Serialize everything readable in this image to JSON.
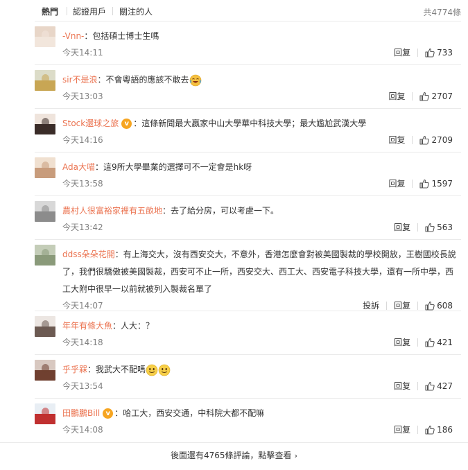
{
  "tabs": [
    {
      "label": "熱門",
      "active": true
    },
    {
      "label": "認證用戶",
      "active": false
    },
    {
      "label": "關注的人",
      "active": false
    }
  ],
  "total_count": "共4774條",
  "actions": {
    "reply": "回复",
    "report": "投訴"
  },
  "comments": [
    {
      "user": "-Vnn-",
      "verified": false,
      "text": "包括碩士博士生嗎",
      "emoji": [],
      "time": "今天14:11",
      "likes": "733",
      "avatar_colors": [
        "#e8d6c8",
        "#f2e6dc"
      ]
    },
    {
      "user": "sir不是浪",
      "verified": false,
      "text": "不會粵語的應該不敢去",
      "emoji": [
        "laugh-cry-emoji"
      ],
      "time": "今天13:03",
      "likes": "2707",
      "avatar_colors": [
        "#dcdcc8",
        "#c8a654"
      ]
    },
    {
      "user": "Stock還球之旅",
      "verified": true,
      "text": "這條新聞最大贏家中山大學華中科技大學；最大尷尬武漢大學",
      "emoji": [],
      "time": "今天14:16",
      "likes": "2709",
      "avatar_colors": [
        "#efe4dc",
        "#3a2c28"
      ]
    },
    {
      "user": "Ada大喵",
      "verified": false,
      "text": "這9所大學畢業的選擇可不一定會是hk呀",
      "emoji": [],
      "time": "今天13:58",
      "likes": "1597",
      "avatar_colors": [
        "#f0e0d0",
        "#c89c7c"
      ]
    },
    {
      "user": "農村人很富裕家裡有五畝地",
      "verified": false,
      "text": "去了給分房，可以考慮一下。",
      "emoji": [],
      "time": "今天13:42",
      "likes": "563",
      "avatar_colors": [
        "#d8d8d8",
        "#8c8c8c"
      ]
    },
    {
      "user": "ddss朵朵花開",
      "verified": false,
      "text": "有上海交大，沒有西安交大，不意外，香港怎麼會對被美國製裁的學校開放，王樹國校長說了，我們很驕傲被美國製裁，西安可不止一所，西安交大、西工大、西安電子科技大學，還有一所中學，西工大附中很早一以前就被列入製裁名單了",
      "emoji": [],
      "time": "今天14:07",
      "likes": "608",
      "report": true,
      "avatar_colors": [
        "#c4cdb8",
        "#8a9a7a"
      ]
    },
    {
      "user": "年年有條大魚",
      "verified": false,
      "text": "人大：？",
      "emoji": [],
      "time": "今天14:18",
      "likes": "421",
      "avatar_colors": [
        "#ece6e2",
        "#6c5a52"
      ]
    },
    {
      "user": "乎乎槑",
      "verified": false,
      "text": "我武大不配嗎",
      "emoji": [
        "smile-emoji",
        "smile-emoji"
      ],
      "time": "今天13:54",
      "likes": "427",
      "avatar_colors": [
        "#d8c8c0",
        "#704030"
      ]
    },
    {
      "user": "田鵬鵬Bill",
      "verified": true,
      "text": "哈工大，西安交通，中科院大都不配嘛",
      "emoji": [],
      "time": "今天14:08",
      "likes": "186",
      "avatar_colors": [
        "#e8eef4",
        "#c03030"
      ]
    }
  ],
  "more_comments": "後面還有4765條評論，點擊查看"
}
